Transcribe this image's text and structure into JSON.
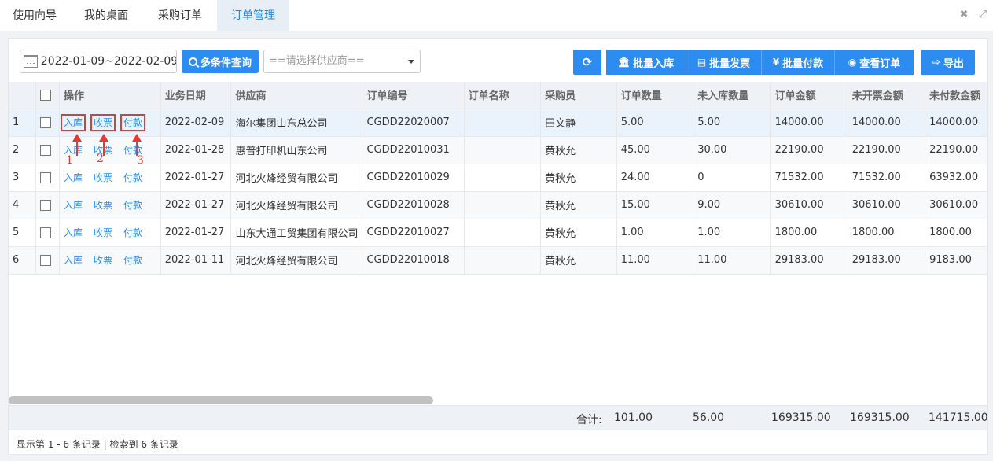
{
  "tabs": [
    {
      "label": "使用向导"
    },
    {
      "label": "我的桌面"
    },
    {
      "label": "采购订单"
    },
    {
      "label": "订单管理"
    }
  ],
  "toolbar": {
    "date_range": "2022-01-09~2022-02-09",
    "query_label": "多条件查询",
    "supplier_placeholder": "==请选择供应商==",
    "refresh_icon": "refresh-icon",
    "batch_stock_in": "批量入库",
    "batch_invoice": "批量发票",
    "batch_payment": "批量付款",
    "view_order": "查看订单",
    "export": "导出"
  },
  "table": {
    "columns": [
      "操作",
      "业务日期",
      "供应商",
      "订单编号",
      "订单名称",
      "采购员",
      "订单数量",
      "未入库数量",
      "订单金额",
      "未开票金额",
      "未付款金额"
    ],
    "op_labels": {
      "stock_in": "入库",
      "invoice": "收票",
      "pay": "付款"
    },
    "rows": [
      {
        "no": "1",
        "date": "2022-02-09",
        "supplier": "海尔集团山东总公司",
        "code": "CGDD22020007",
        "name": "",
        "buyer": "田文静",
        "qty": "5.00",
        "pending_qty": "5.00",
        "amount": "14000.00",
        "uninvoiced": "14000.00",
        "unpaid": "14000.00"
      },
      {
        "no": "2",
        "date": "2022-01-28",
        "supplier": "惠普打印机山东公司",
        "code": "CGDD22010031",
        "name": "",
        "buyer": "黄秋允",
        "qty": "45.00",
        "pending_qty": "30.00",
        "amount": "22190.00",
        "uninvoiced": "22190.00",
        "unpaid": "22190.00"
      },
      {
        "no": "3",
        "date": "2022-01-27",
        "supplier": "河北火烽经贸有限公司",
        "code": "CGDD22010029",
        "name": "",
        "buyer": "黄秋允",
        "qty": "24.00",
        "pending_qty": "0",
        "amount": "71532.00",
        "uninvoiced": "71532.00",
        "unpaid": "63932.00"
      },
      {
        "no": "4",
        "date": "2022-01-27",
        "supplier": "河北火烽经贸有限公司",
        "code": "CGDD22010028",
        "name": "",
        "buyer": "黄秋允",
        "qty": "15.00",
        "pending_qty": "9.00",
        "amount": "30610.00",
        "uninvoiced": "30610.00",
        "unpaid": "30610.00"
      },
      {
        "no": "5",
        "date": "2022-01-27",
        "supplier": "山东大通工贸集团有限公司",
        "code": "CGDD22010027",
        "name": "",
        "buyer": "黄秋允",
        "qty": "1.00",
        "pending_qty": "1.00",
        "amount": "1800.00",
        "uninvoiced": "1800.00",
        "unpaid": "1800.00"
      },
      {
        "no": "6",
        "date": "2022-01-11",
        "supplier": "河北火烽经贸有限公司",
        "code": "CGDD22010018",
        "name": "",
        "buyer": "黄秋允",
        "qty": "11.00",
        "pending_qty": "11.00",
        "amount": "29183.00",
        "uninvoiced": "29183.00",
        "unpaid": "9183.00"
      }
    ],
    "totals": {
      "label": "合计:",
      "qty": "101.00",
      "pending_qty": "56.00",
      "amount": "169315.00",
      "uninvoiced": "169315.00",
      "unpaid": "141715.00"
    }
  },
  "pager": "显示第 1 - 6 条记录 | 检索到 6 条记录",
  "annotations": [
    "1",
    "2",
    "3"
  ],
  "colors": {
    "accent": "#2d8cf0",
    "highlight": "#e53935"
  }
}
